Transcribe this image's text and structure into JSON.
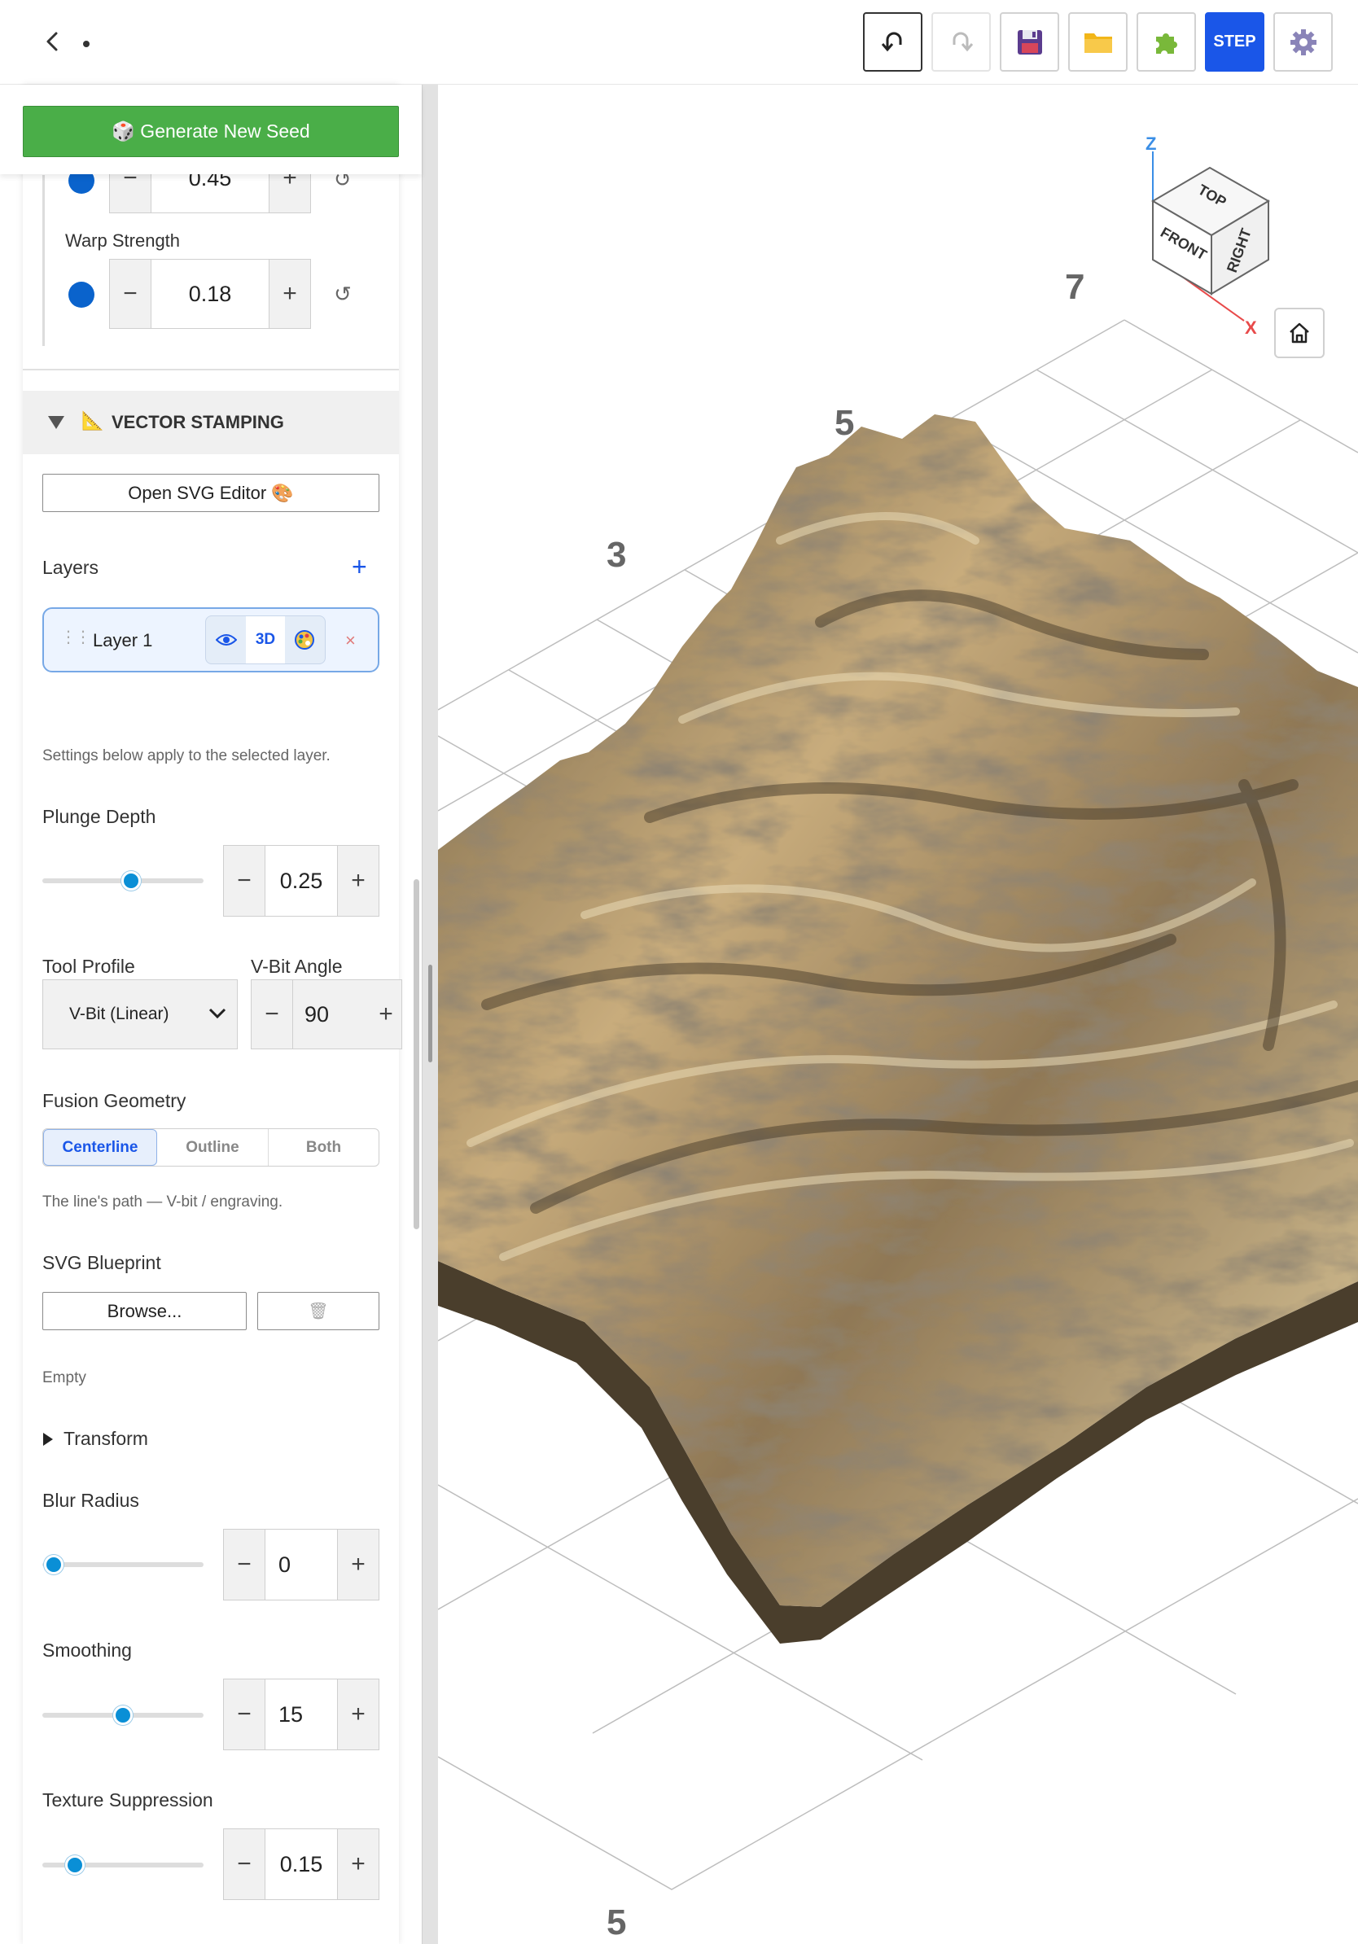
{
  "topbar": {
    "step_label": "STEP"
  },
  "sidebar": {
    "generate_button": "🎲 Generate New Seed",
    "prev_value": "0.45",
    "warp_strength": {
      "label": "Warp Strength",
      "value": "0.18"
    },
    "vector_section": {
      "title": "VECTOR STAMPING",
      "icon": "📐"
    },
    "open_svg_editor": "Open SVG Editor 🎨",
    "layers": {
      "label": "Layers",
      "add": "+",
      "items": [
        {
          "name": "Layer 1",
          "badge_3d": "3D"
        }
      ],
      "remove": "×"
    },
    "settings_hint": "Settings below apply to the selected layer.",
    "plunge_depth": {
      "label": "Plunge Depth",
      "value": "0.25",
      "fraction": 0.55
    },
    "tool_profile": {
      "label": "Tool Profile",
      "selected": "V-Bit (Linear)"
    },
    "vbit_angle": {
      "label": "V-Bit Angle",
      "value": "90"
    },
    "fusion_geometry": {
      "label": "Fusion Geometry",
      "options": [
        "Centerline",
        "Outline",
        "Both"
      ],
      "selected": "Centerline",
      "hint": "The line's path — V-bit / engraving."
    },
    "svg_blueprint": {
      "label": "SVG Blueprint",
      "browse": "Browse...",
      "trash_icon": "🗑",
      "status": "Empty"
    },
    "transform": {
      "label": "Transform"
    },
    "blur_radius": {
      "label": "Blur Radius",
      "value": "0",
      "fraction": 0.07
    },
    "smoothing": {
      "label": "Smoothing",
      "value": "15",
      "fraction": 0.5
    },
    "texture_suppression": {
      "label": "Texture Suppression",
      "value": "0.15",
      "fraction": 0.2
    }
  },
  "viewport": {
    "axis_z": "Z",
    "axis_x": "X",
    "cube_top": "TOP",
    "cube_front": "FRONT",
    "cube_right": "RIGHT",
    "grid_labels": [
      "7",
      "5",
      "3",
      "5"
    ]
  }
}
